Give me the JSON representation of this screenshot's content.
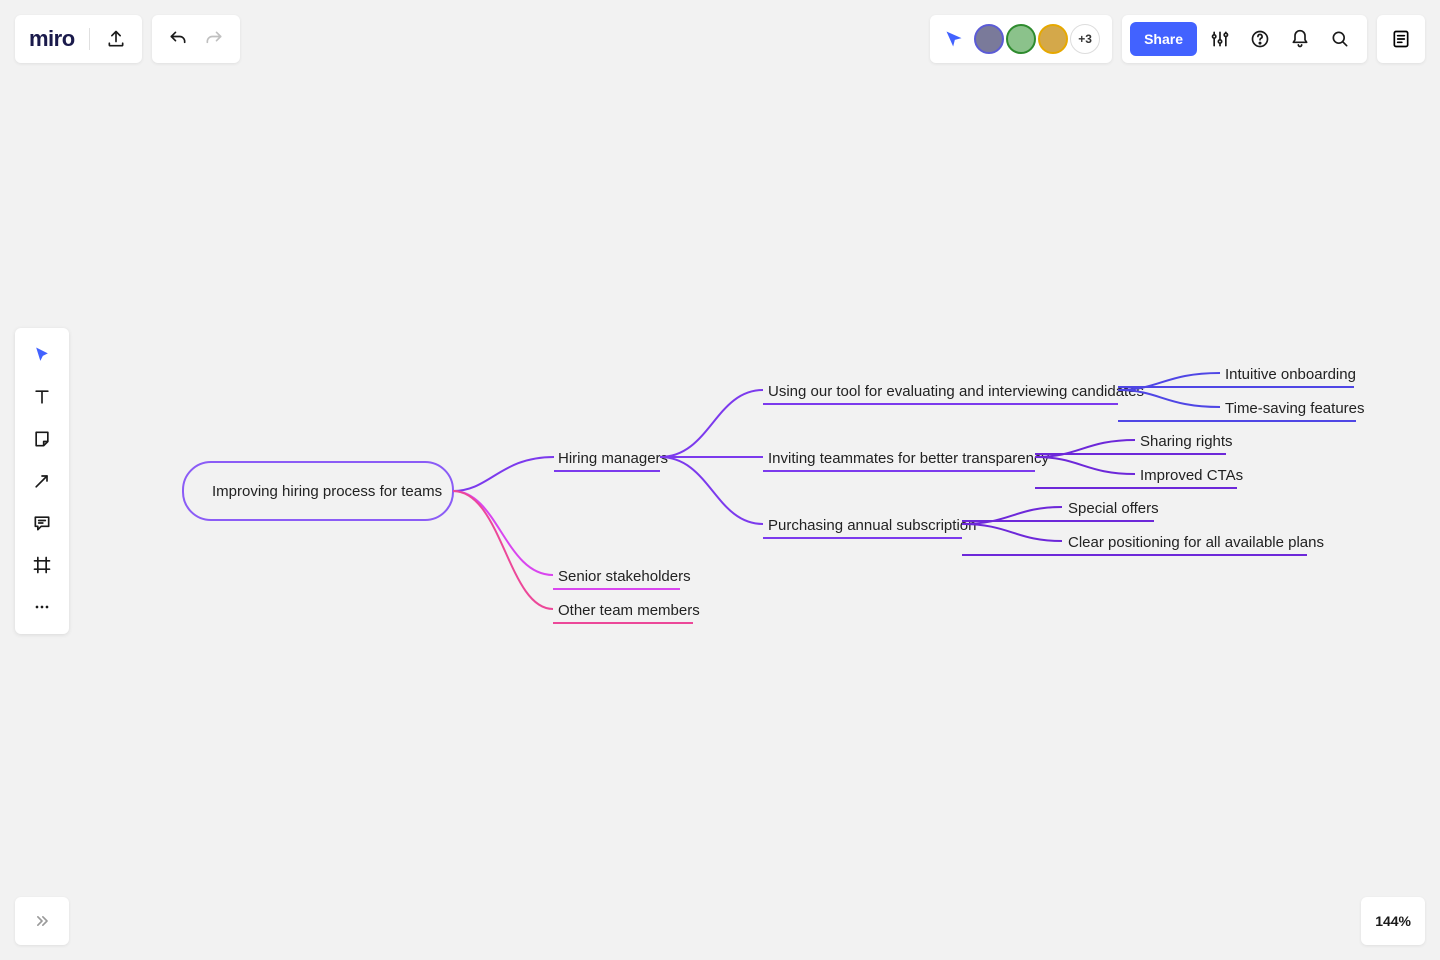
{
  "app": {
    "logo": "miro"
  },
  "collab": {
    "more_count": "+3"
  },
  "actions": {
    "share_label": "Share"
  },
  "zoom": {
    "value": "144%"
  },
  "mindmap": {
    "root": "Improving hiring process for teams",
    "l1": {
      "a": "Hiring managers",
      "b": "Senior stakeholders",
      "c": "Other team members"
    },
    "l2": {
      "a": "Using our tool for evaluating and interviewing candidates",
      "b": "Inviting teammates for better transparency",
      "c": "Purchasing annual subscription"
    },
    "l3": {
      "a": "Intuitive onboarding",
      "b": "Time-saving features",
      "c": "Sharing rights",
      "d": "Improved CTAs",
      "e": "Special offers",
      "f": "Clear positioning for all available plans"
    }
  }
}
